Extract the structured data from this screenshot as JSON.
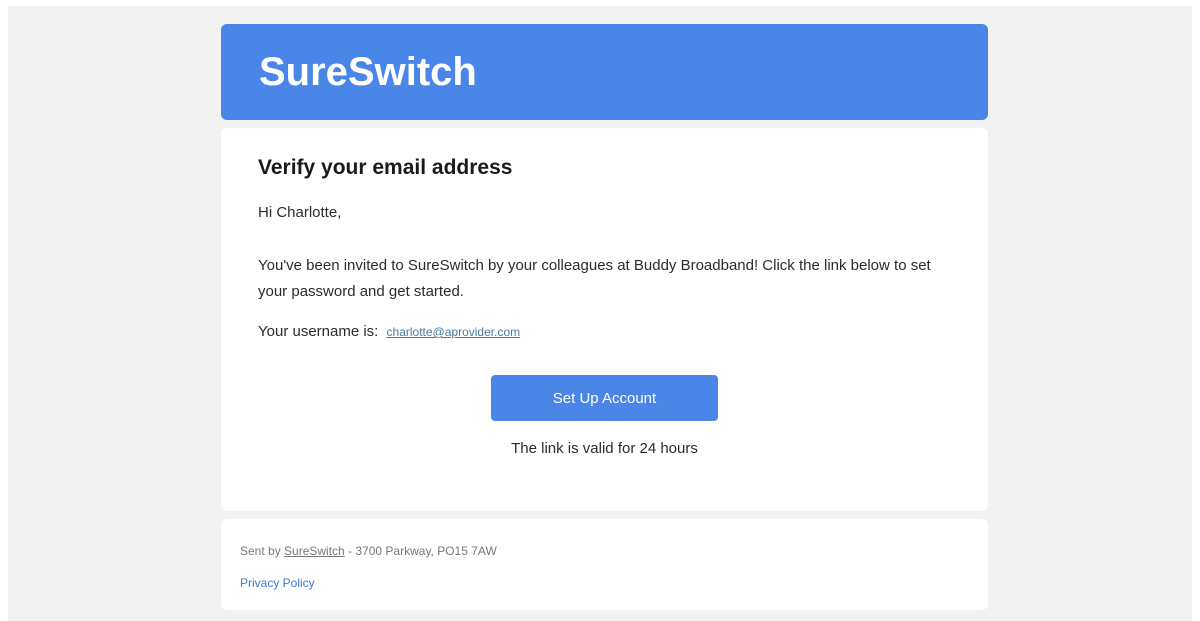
{
  "header": {
    "brand": "SureSwitch"
  },
  "card": {
    "title": "Verify your email address",
    "greeting": "Hi Charlotte,",
    "body": "You've been invited to SureSwitch by your colleagues at Buddy Broadband! Click the link below to set your password and get started.",
    "username_label": "Your username is:",
    "username": "charlotte@aprovider.com",
    "cta_label": "Set Up Account",
    "validity": "The link is valid for 24 hours"
  },
  "footer": {
    "sent_by_prefix": "Sent by ",
    "sent_by_link": "SureSwitch",
    "sent_by_suffix": " - 3700 Parkway, PO15 7AW",
    "privacy": "Privacy Policy"
  },
  "colors": {
    "brand_blue": "#4a86e8",
    "background": "#f2f2f2",
    "link_blue": "#3c78d8"
  }
}
